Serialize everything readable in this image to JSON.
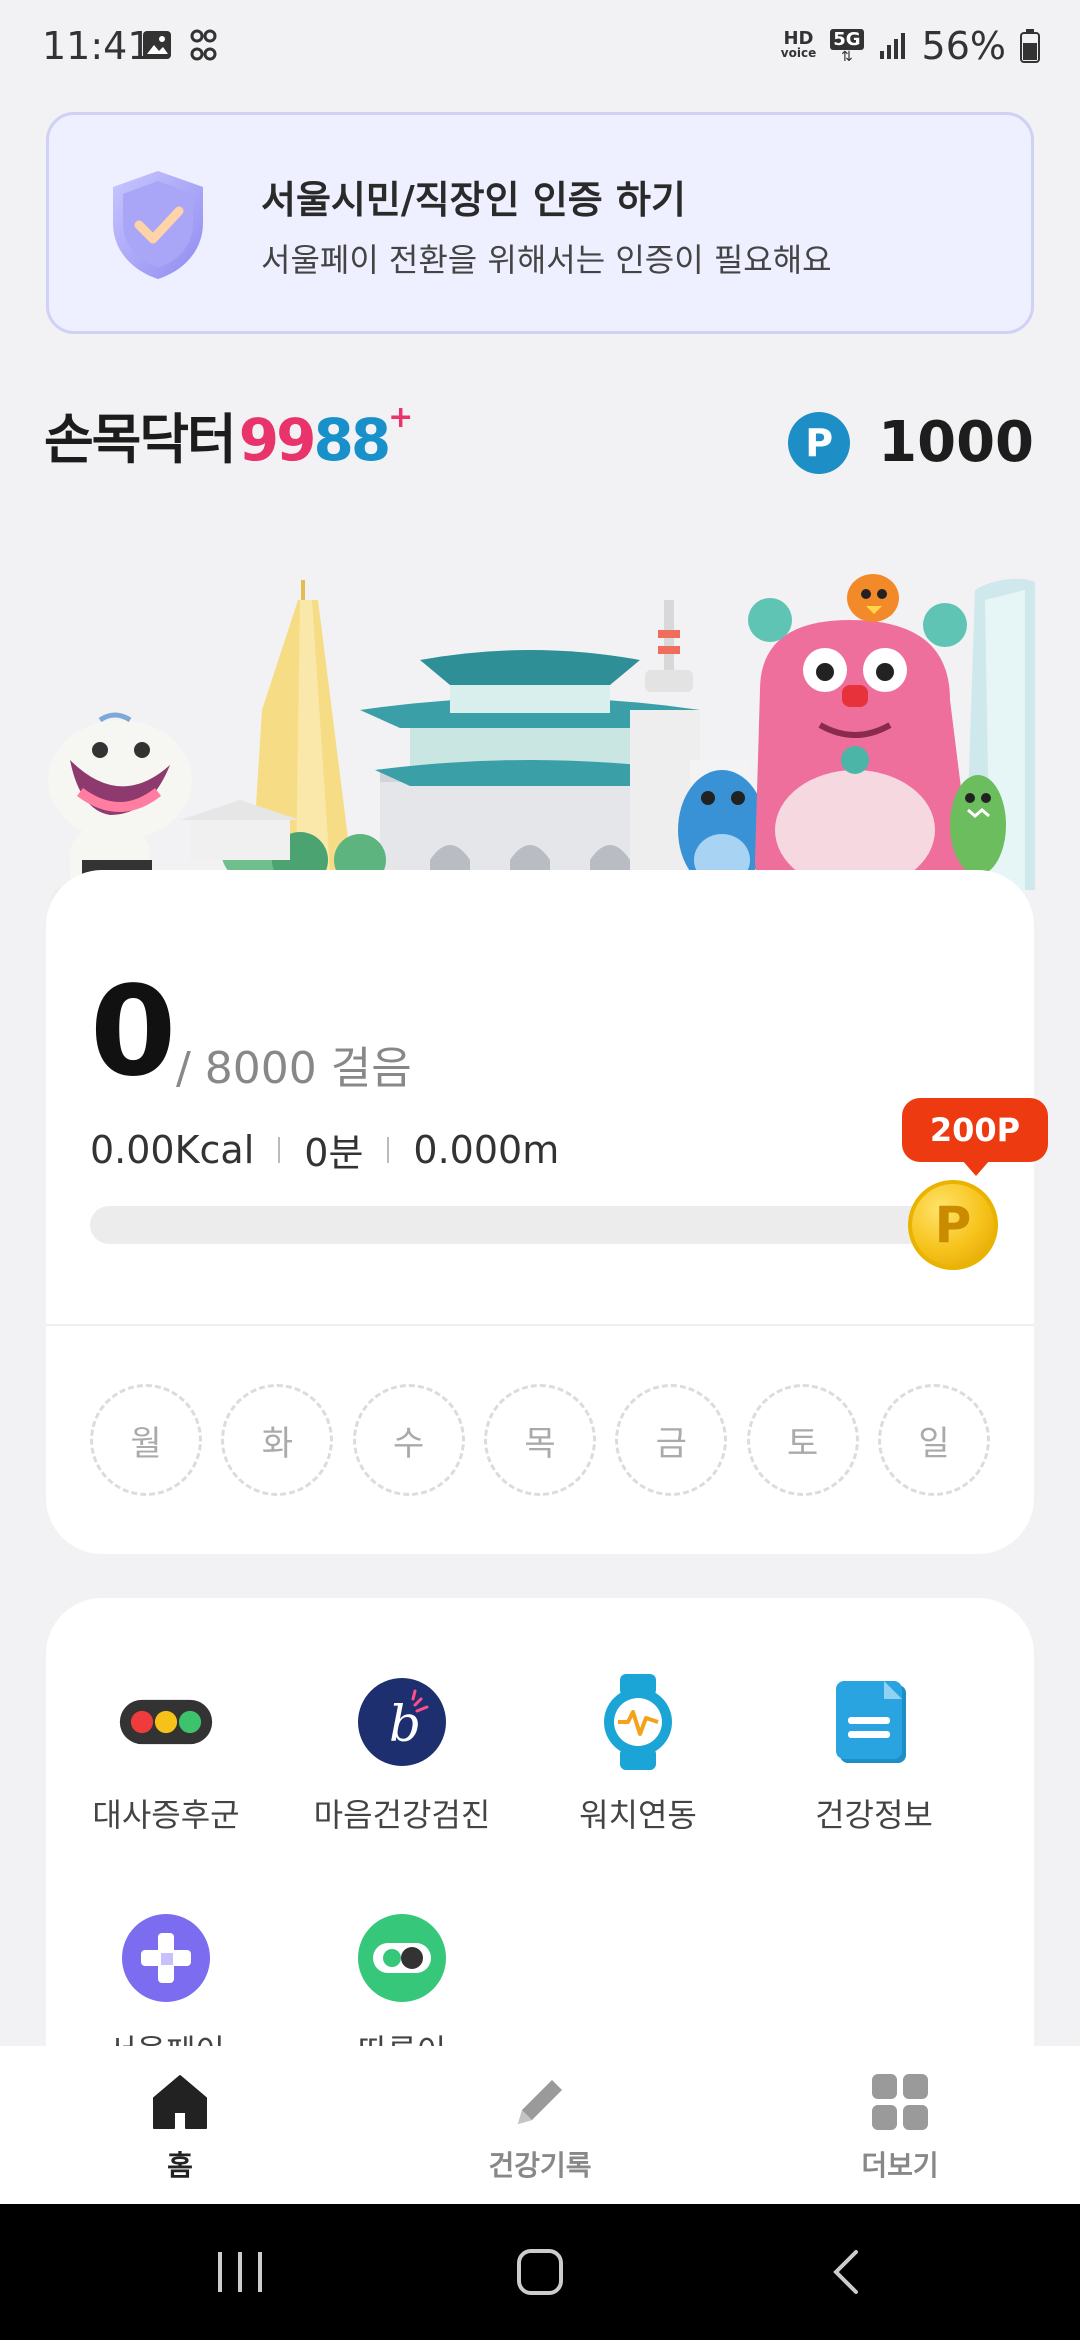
{
  "status_bar": {
    "time": "11:41",
    "hd_label": "HD",
    "voice_label": "voice",
    "network": "5G",
    "battery": "56%"
  },
  "cert_banner": {
    "title": "서울시민/직장인 인증 하기",
    "subtitle": "서울페이 전환을 위해서는 인증이 필요해요",
    "icon": "shield-check-icon"
  },
  "logo": {
    "text": "손목닥터",
    "n1": "9",
    "n2": "9",
    "n3": "8",
    "n4": "8",
    "plus": "+"
  },
  "points": {
    "badge": "P",
    "value": "1000"
  },
  "steps": {
    "count": "0",
    "goal": "/ 8000 걸음",
    "kcal": "0.00Kcal",
    "minutes": "0분",
    "distance": "0.000m",
    "progress": 0,
    "reward": "200P",
    "coin_label": "P",
    "weekdays": [
      "월",
      "화",
      "수",
      "목",
      "금",
      "토",
      "일"
    ]
  },
  "menu": {
    "items": [
      {
        "label": "대사증후군",
        "icon": "traffic-light-icon"
      },
      {
        "label": "마음건강검진",
        "icon": "mind-b-icon"
      },
      {
        "label": "워치연동",
        "icon": "watch-icon"
      },
      {
        "label": "건강정보",
        "icon": "document-icon"
      },
      {
        "label": "서울페이",
        "icon": "seoulpay-plus-icon"
      },
      {
        "label": "따릉이",
        "icon": "bike-toggle-icon"
      }
    ]
  },
  "bottom_nav": {
    "items": [
      {
        "label": "홈",
        "icon": "home-icon",
        "active": true
      },
      {
        "label": "건강기록",
        "icon": "pencil-icon",
        "active": false
      },
      {
        "label": "더보기",
        "icon": "grid-icon",
        "active": false
      }
    ]
  },
  "colors": {
    "brand_blue": "#1e8fc6",
    "brand_pink": "#e8336b",
    "reward_red": "#ee3a10",
    "banner_bg": "#eeefff"
  }
}
